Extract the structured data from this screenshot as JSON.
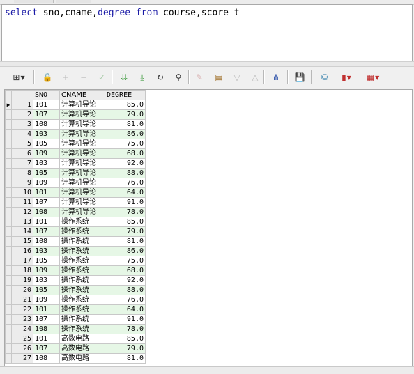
{
  "sql": {
    "tokens": [
      {
        "t": "select",
        "kw": true
      },
      {
        "t": " sno,cname,",
        "kw": false
      },
      {
        "t": "degree",
        "kw": true
      },
      {
        "t": " ",
        "kw": false
      },
      {
        "t": "from",
        "kw": true
      },
      {
        "t": " course,score t",
        "kw": false
      }
    ]
  },
  "toolbar": [
    {
      "name": "grid-layout-button",
      "glyph": "⊞",
      "dropdown": true,
      "enabled": true,
      "color": "#333333"
    },
    {
      "name": "lock-icon",
      "glyph": "🔒",
      "enabled": true,
      "color": "#555555"
    },
    {
      "name": "insert-record-button",
      "glyph": "+",
      "enabled": false,
      "color": "#555555"
    },
    {
      "name": "delete-record-button",
      "glyph": "−",
      "enabled": false,
      "color": "#555555"
    },
    {
      "name": "post-changes-button",
      "glyph": "✓",
      "enabled": false,
      "color": "#2e8b2e"
    },
    {
      "name": "fetch-next-button",
      "glyph": "⇊",
      "enabled": true,
      "color": "#1c8a1c"
    },
    {
      "name": "fetch-last-button",
      "glyph": "⤓",
      "enabled": true,
      "color": "#1c8a1c"
    },
    {
      "name": "refresh-button",
      "glyph": "↻",
      "enabled": true,
      "color": "#333333"
    },
    {
      "name": "find-binoculars-icon",
      "glyph": "⚲",
      "enabled": true,
      "color": "#333333"
    },
    {
      "name": "clear-eraser-icon",
      "glyph": "✎",
      "enabled": false,
      "color": "#b04040"
    },
    {
      "name": "query-by-example-button",
      "glyph": "▤",
      "enabled": true,
      "color": "#a0702a"
    },
    {
      "name": "previous-button",
      "glyph": "▽",
      "enabled": false,
      "color": "#555555"
    },
    {
      "name": "next-button",
      "glyph": "△",
      "enabled": false,
      "color": "#555555"
    },
    {
      "name": "tree-view-button",
      "glyph": "⋔",
      "enabled": true,
      "color": "#2a4fa8"
    },
    {
      "name": "save-icon",
      "glyph": "💾",
      "enabled": true,
      "color": "#333333"
    },
    {
      "name": "export-database-button",
      "glyph": "⛁",
      "enabled": true,
      "color": "#2a7aa8"
    },
    {
      "name": "chart-button",
      "glyph": "▮",
      "dropdown": true,
      "enabled": true,
      "color": "#c03030"
    },
    {
      "name": "table-export-button",
      "glyph": "▦",
      "dropdown": true,
      "enabled": true,
      "color": "#c03030"
    }
  ],
  "grid": {
    "columns": [
      "SNO",
      "CNAME",
      "DEGREE"
    ],
    "current_row_marker": "▶",
    "rows": [
      [
        "1",
        "101",
        "计算机导论",
        "85.0"
      ],
      [
        "2",
        "107",
        "计算机导论",
        "79.0"
      ],
      [
        "3",
        "108",
        "计算机导论",
        "81.0"
      ],
      [
        "4",
        "103",
        "计算机导论",
        "86.0"
      ],
      [
        "5",
        "105",
        "计算机导论",
        "75.0"
      ],
      [
        "6",
        "109",
        "计算机导论",
        "68.0"
      ],
      [
        "7",
        "103",
        "计算机导论",
        "92.0"
      ],
      [
        "8",
        "105",
        "计算机导论",
        "88.0"
      ],
      [
        "9",
        "109",
        "计算机导论",
        "76.0"
      ],
      [
        "10",
        "101",
        "计算机导论",
        "64.0"
      ],
      [
        "11",
        "107",
        "计算机导论",
        "91.0"
      ],
      [
        "12",
        "108",
        "计算机导论",
        "78.0"
      ],
      [
        "13",
        "101",
        "操作系统",
        "85.0"
      ],
      [
        "14",
        "107",
        "操作系统",
        "79.0"
      ],
      [
        "15",
        "108",
        "操作系统",
        "81.0"
      ],
      [
        "16",
        "103",
        "操作系统",
        "86.0"
      ],
      [
        "17",
        "105",
        "操作系统",
        "75.0"
      ],
      [
        "18",
        "109",
        "操作系统",
        "68.0"
      ],
      [
        "19",
        "103",
        "操作系统",
        "92.0"
      ],
      [
        "20",
        "105",
        "操作系统",
        "88.0"
      ],
      [
        "21",
        "109",
        "操作系统",
        "76.0"
      ],
      [
        "22",
        "101",
        "操作系统",
        "64.0"
      ],
      [
        "23",
        "107",
        "操作系统",
        "91.0"
      ],
      [
        "24",
        "108",
        "操作系统",
        "78.0"
      ],
      [
        "25",
        "101",
        "高数电路",
        "85.0"
      ],
      [
        "26",
        "107",
        "高数电路",
        "79.0"
      ],
      [
        "27",
        "108",
        "高数电路",
        "81.0"
      ]
    ]
  }
}
